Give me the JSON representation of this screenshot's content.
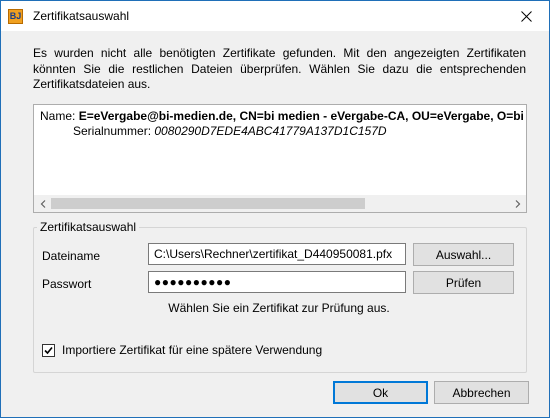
{
  "window": {
    "title": "Zertifikatsauswahl",
    "icon_text": "BJ"
  },
  "info_text": "Es wurden nicht alle benötigten Zertifikate gefunden. Mit den angezeigten Zertifikaten könnten Sie die restlichen Dateien überprüfen. Wählen Sie dazu die entsprechenden Zertifikatsdateien aus.",
  "certificate": {
    "name_label": "Name:",
    "name_value": "E=eVergabe@bi-medien.de, CN=bi medien - eVergabe-CA, OU=eVergabe, O=bi",
    "serial_label": "Serialnummer:",
    "serial_value": "0080290D7EDE4ABC41779A137D1C157D"
  },
  "group": {
    "legend": "Zertifikatsauswahl",
    "file_label": "Dateiname",
    "file_value": "C:\\Users\\Rechner\\zertifikat_D440950081.pfx",
    "browse_button": "Auswahl...",
    "password_label": "Passwort",
    "password_value": "●●●●●●●●●●",
    "check_button": "Prüfen",
    "hint": "Wählen Sie ein Zertifikat zur Prüfung aus.",
    "import_checkbox_label": "Importiere Zertifikat für eine spätere Verwendung",
    "import_checked": true
  },
  "buttons": {
    "ok": "Ok",
    "cancel": "Abbrechen"
  },
  "colors": {
    "window_border": "#1f6fb8",
    "dialog_bg": "#f0f0f0",
    "button_bg": "#e1e1e1",
    "focus_border": "#0078d7"
  }
}
